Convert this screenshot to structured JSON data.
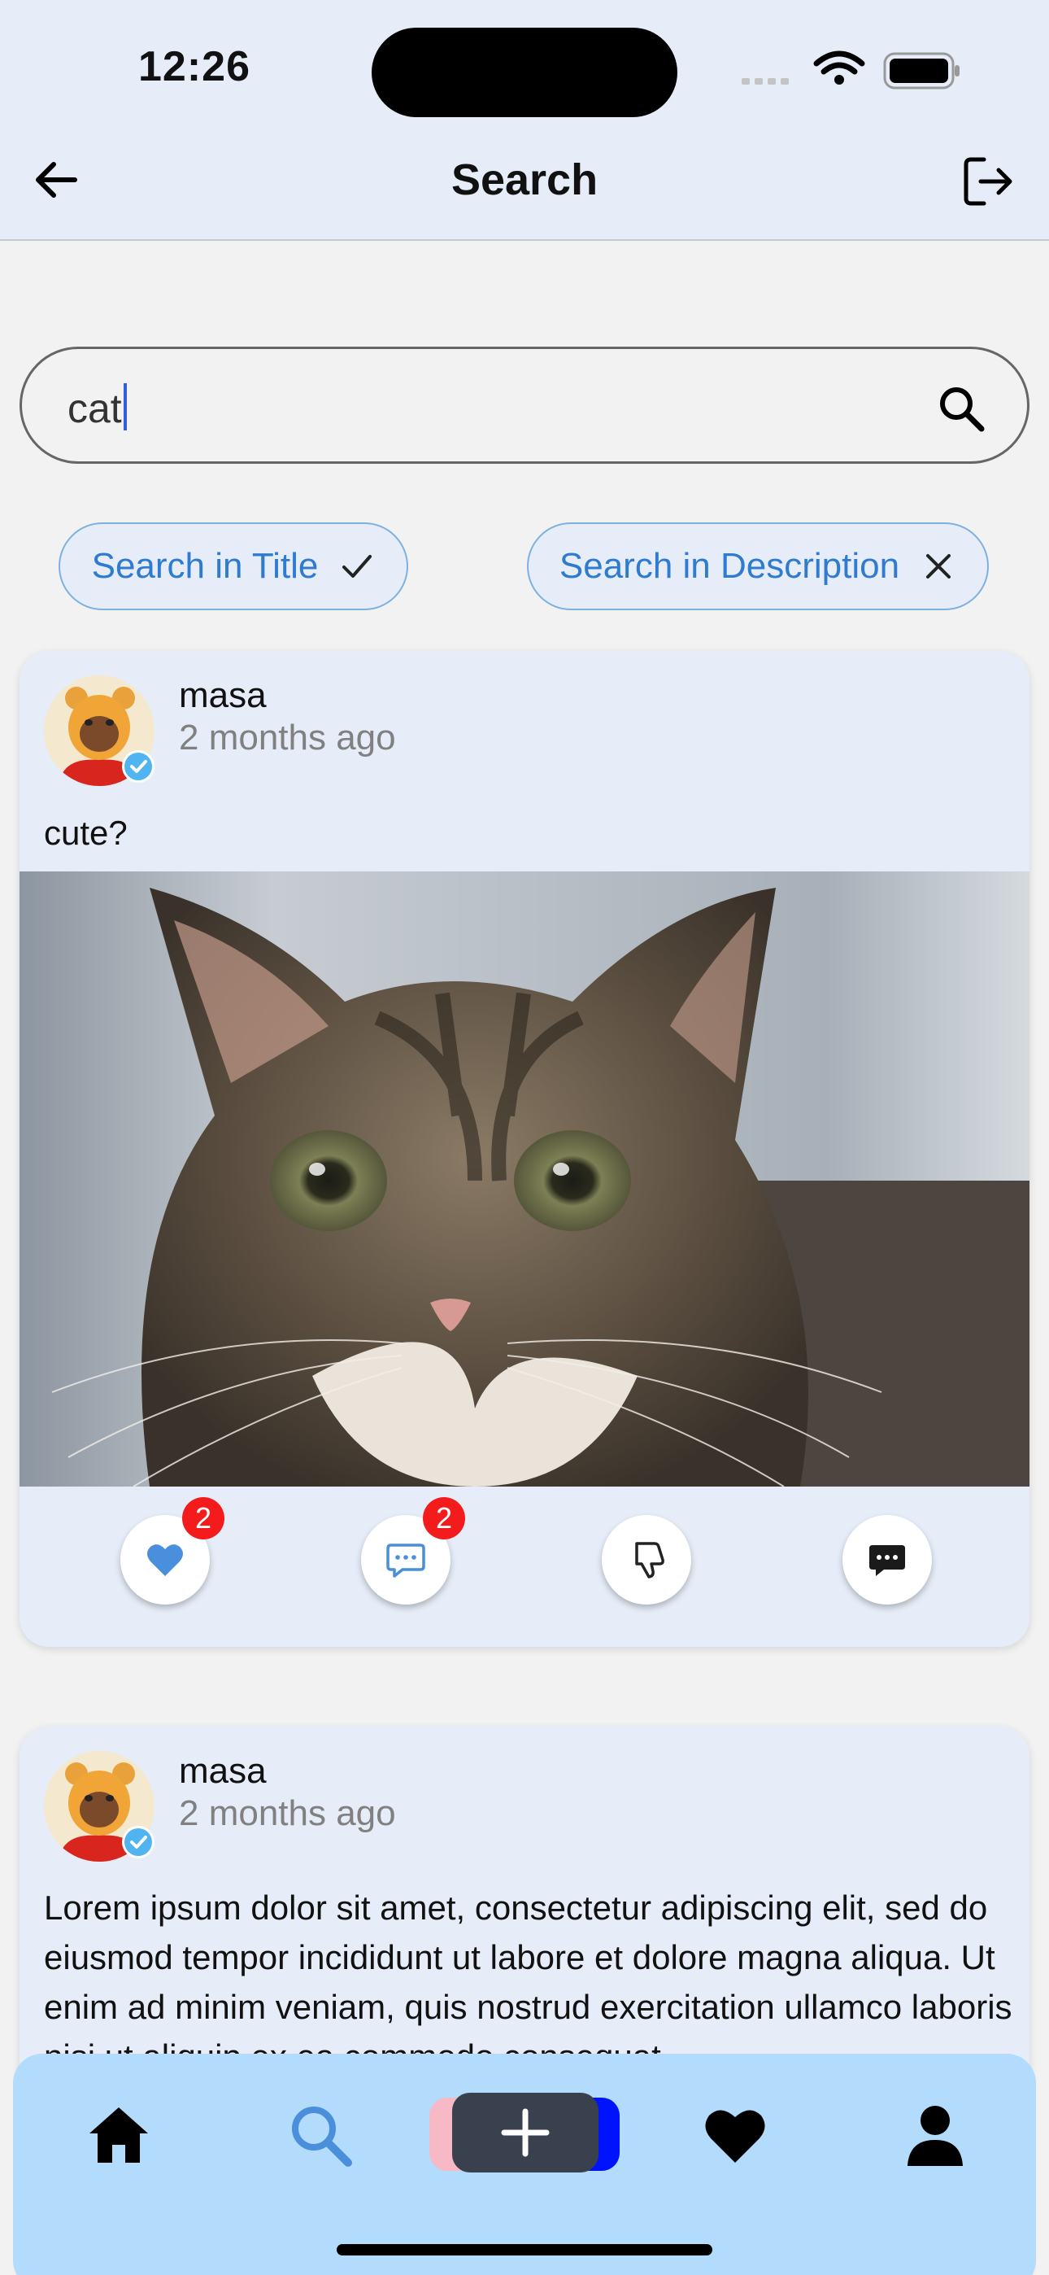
{
  "status_bar": {
    "time": "12:26"
  },
  "header": {
    "title": "Search",
    "back_icon": "arrow-left-icon",
    "logout_icon": "logout-icon"
  },
  "search": {
    "value": "cat",
    "icon": "search-icon"
  },
  "filters": [
    {
      "label": "Search in Title",
      "state": "checked",
      "icon": "check-icon"
    },
    {
      "label": "Search in Description",
      "state": "unchecked",
      "icon": "close-icon"
    }
  ],
  "posts": [
    {
      "author": "masa",
      "time_ago": "2 months ago",
      "title": "cute?",
      "image": "kitten-photo",
      "likes": "2",
      "comments": "2"
    },
    {
      "author": "masa",
      "time_ago": "2 months ago",
      "body": "Lorem ipsum dolor sit amet, consectetur adipiscing elit, sed do eiusmod tempor incididunt ut labore et dolore magna aliqua. Ut enim ad minim veniam, quis nostrud exercitation ullamco laboris nisi ut aliquip ex ea commodo consequat."
    }
  ],
  "tabbar": {
    "items": [
      "home-icon",
      "search-icon",
      "add-icon",
      "heart-icon",
      "profile-icon"
    ],
    "active": "search-icon"
  },
  "colors": {
    "header_bg": "#e6edf8",
    "card_bg": "#e6edf8",
    "chip_text": "#2f7bd0",
    "badge": "#f31b1b",
    "like": "#4a8fdc",
    "tabbar_bg": "#b3dbfb",
    "tab_active": "#4a8fdc"
  }
}
